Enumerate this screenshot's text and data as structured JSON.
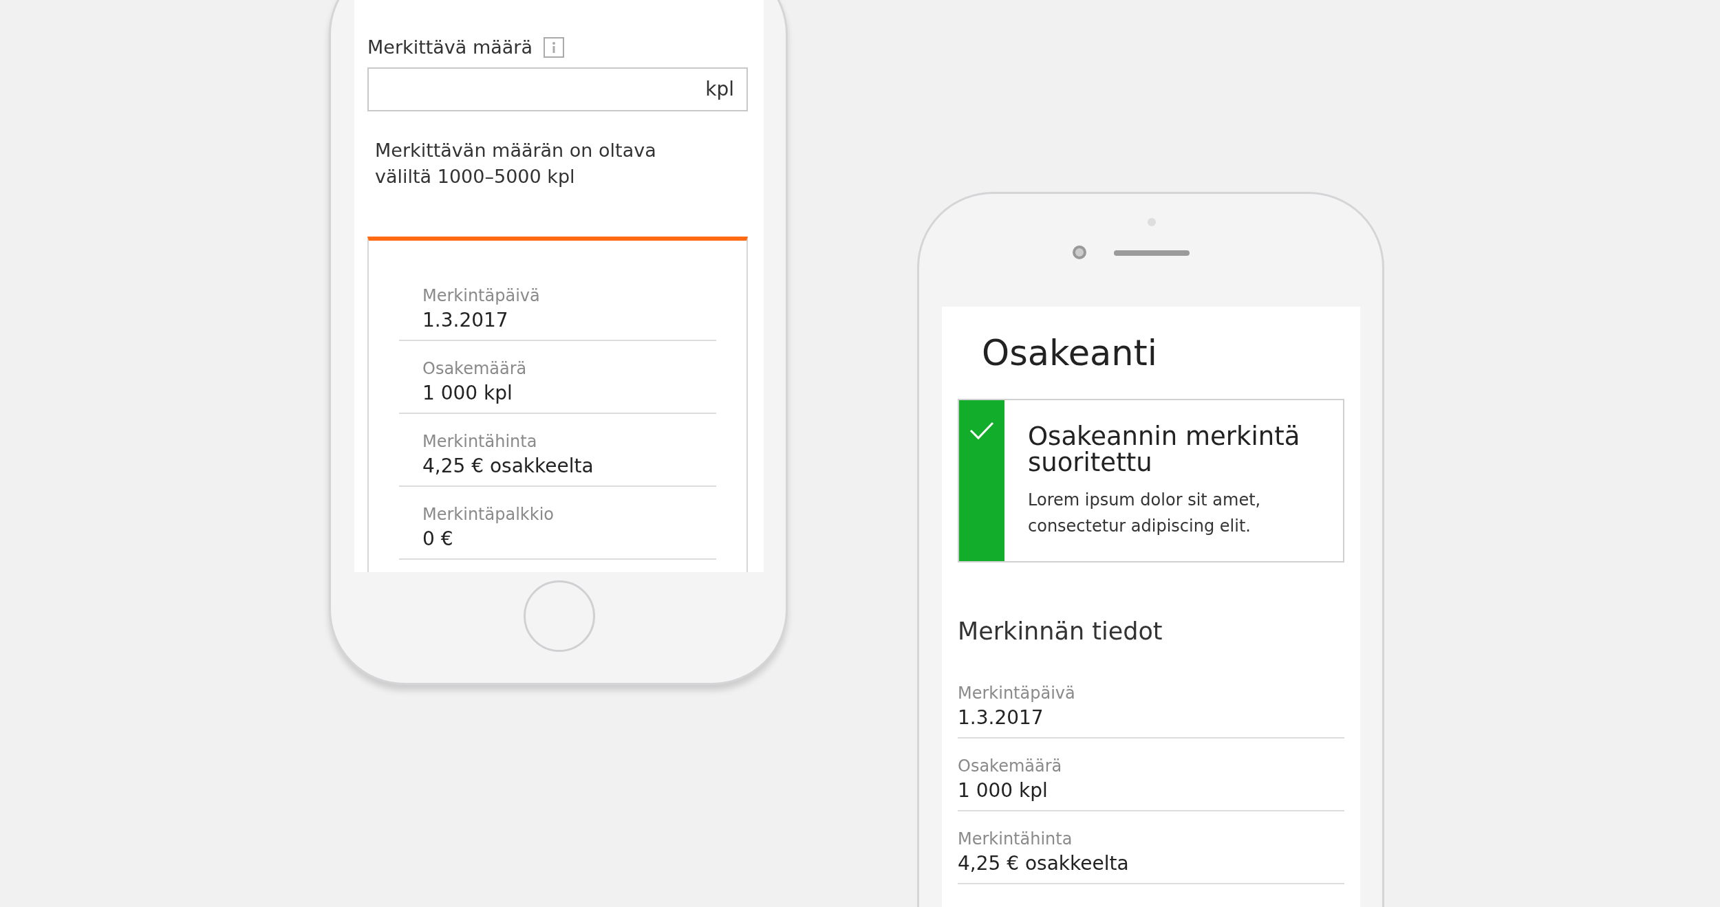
{
  "left_phone": {
    "screen": {
      "quantity_field": {
        "label": "Merkittävä määrä",
        "unit": "kpl"
      },
      "helper_text": "Merkittävän määrän on oltava väliltä 1000–5000 kpl",
      "details_card": {
        "rows": [
          {
            "label": "Merkintäpäivä",
            "value": "1.3.2017"
          },
          {
            "label": "Osakemäärä",
            "value": "1 000 kpl"
          },
          {
            "label": "Merkintähinta",
            "value": "4,25 € osakkeelta"
          },
          {
            "label": "Merkintäpalkkio",
            "value": "0 €"
          }
        ]
      }
    }
  },
  "right_phone": {
    "screen": {
      "title": "Osakeanti",
      "success_notice": {
        "title": "Osakeannin merkintä suoritettu",
        "body": "Lorem ipsum dolor sit amet, consectetur adipiscing elit."
      },
      "section_title": "Merkinnän tiedot",
      "rows": [
        {
          "label": "Merkintäpäivä",
          "value": "1.3.2017"
        },
        {
          "label": "Osakemäärä",
          "value": "1 000 kpl"
        },
        {
          "label": "Merkintähinta",
          "value": "4,25 € osakkeelta"
        }
      ]
    }
  }
}
